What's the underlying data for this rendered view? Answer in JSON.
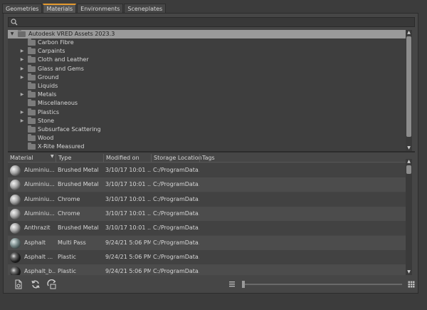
{
  "tabs": [
    {
      "label": "Geometries",
      "active": false
    },
    {
      "label": "Materials",
      "active": true
    },
    {
      "label": "Environments",
      "active": false
    },
    {
      "label": "Sceneplates",
      "active": false
    }
  ],
  "search": {
    "placeholder": "",
    "value": ""
  },
  "tree": {
    "root": "Autodesk VRED Assets 2023.3",
    "items": [
      {
        "label": "Carbon Fibre",
        "expandable": false
      },
      {
        "label": "Carpaints",
        "expandable": true
      },
      {
        "label": "Cloth and Leather",
        "expandable": true
      },
      {
        "label": "Glass and Gems",
        "expandable": true
      },
      {
        "label": "Ground",
        "expandable": true
      },
      {
        "label": "Liquids",
        "expandable": false
      },
      {
        "label": "Metals",
        "expandable": true
      },
      {
        "label": "Miscellaneous",
        "expandable": false
      },
      {
        "label": "Plastics",
        "expandable": true
      },
      {
        "label": "Stone",
        "expandable": true
      },
      {
        "label": "Subsurface Scattering",
        "expandable": false
      },
      {
        "label": "Wood",
        "expandable": false
      },
      {
        "label": "X-Rite Measured",
        "expandable": false
      }
    ]
  },
  "table": {
    "columns": [
      "Material",
      "Type",
      "Modified on",
      "Storage Location",
      "Tags"
    ],
    "rows": [
      {
        "material": "Aluminiu...",
        "type": "Brushed Metal",
        "modified": "3/10/17 10:01 ...",
        "location": "C:/ProgramData...",
        "tags": "",
        "icon": "metal"
      },
      {
        "material": "Aluminiu...",
        "type": "Brushed Metal",
        "modified": "3/10/17 10:01 ...",
        "location": "C:/ProgramData...",
        "tags": "",
        "icon": "metal"
      },
      {
        "material": "Aluminiu...",
        "type": "Chrome",
        "modified": "3/10/17 10:01 ...",
        "location": "C:/ProgramData...",
        "tags": "",
        "icon": "metal"
      },
      {
        "material": "Aluminiu...",
        "type": "Chrome",
        "modified": "3/10/17 10:01 ...",
        "location": "C:/ProgramData...",
        "tags": "",
        "icon": "metal"
      },
      {
        "material": "Anthrazit",
        "type": "Brushed Metal",
        "modified": "3/10/17 10:01 ...",
        "location": "C:/ProgramData...",
        "tags": "",
        "icon": "metal"
      },
      {
        "material": "Asphalt",
        "type": "Multi Pass",
        "modified": "9/24/21 5:06 PM",
        "location": "C:/ProgramData...",
        "tags": "",
        "icon": "asphalt"
      },
      {
        "material": "Asphalt ...",
        "type": "Plastic",
        "modified": "9/24/21 5:06 PM",
        "location": "C:/ProgramData...",
        "tags": "",
        "icon": "dark"
      },
      {
        "material": "Asphalt_b...",
        "type": "Plastic",
        "modified": "9/24/21 5:06 PM",
        "location": "C:/ProgramData...",
        "tags": "",
        "icon": "dark"
      }
    ]
  },
  "toolbar": {
    "buttons": [
      "new-material-icon",
      "refresh-icon",
      "sync-icon"
    ],
    "zoom_left_icon": "list-view-icon",
    "zoom_right_icon": "grid-view-icon",
    "zoom_level": 0
  },
  "colors": {
    "accent": "#e49a2f",
    "background": "#3c3c3c",
    "panel": "#464646",
    "tree_selection": "#9a9a9a"
  }
}
